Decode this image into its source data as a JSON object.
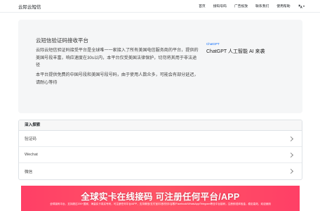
{
  "navbar": {
    "brand": "云际云短信",
    "links": [
      "首页",
      "接码号码",
      "广告投放",
      "联系我们",
      "使用帮助"
    ],
    "language_icon": "translate-icon"
  },
  "hero": {
    "title": "云短信验证码接收平台",
    "paragraph1": "云际云短信验证码接受平台是全球唯一一家接入了所有美国电信服务商的平台，提供的美国号段丰富，响应速度在30s以内，本平台仅受美国法律保护，切勿将其用于非法途径",
    "paragraph2": "本平台提供免费的中国号段和美国号段号码，由于使用人数众多，可能会有部分延迟，请耐心等待",
    "ad": {
      "tag": "ChatGPT",
      "title": "ChatGPT 人工智能 AI 来袭"
    }
  },
  "explore": {
    "header": "深入探索",
    "items": [
      "验证码",
      "Wechat",
      "微信"
    ]
  },
  "banner": {
    "title": "全球实卡在线接码 可注册任何平台/APP",
    "subtitle": "全球接码平台，支持超过200+国家，海量实卡真实号码，可注册任何平台/APP，支持微信/支付宝/抖音/快手/谷歌/Facebook/WhatsApp/Telegram等全平台接码，注册即送体验金，稳定高效，欢迎使用"
  },
  "colors": {
    "accent": "#0d6efd",
    "hero_bg": "#f5f6f7",
    "banner": "#ff4466"
  }
}
